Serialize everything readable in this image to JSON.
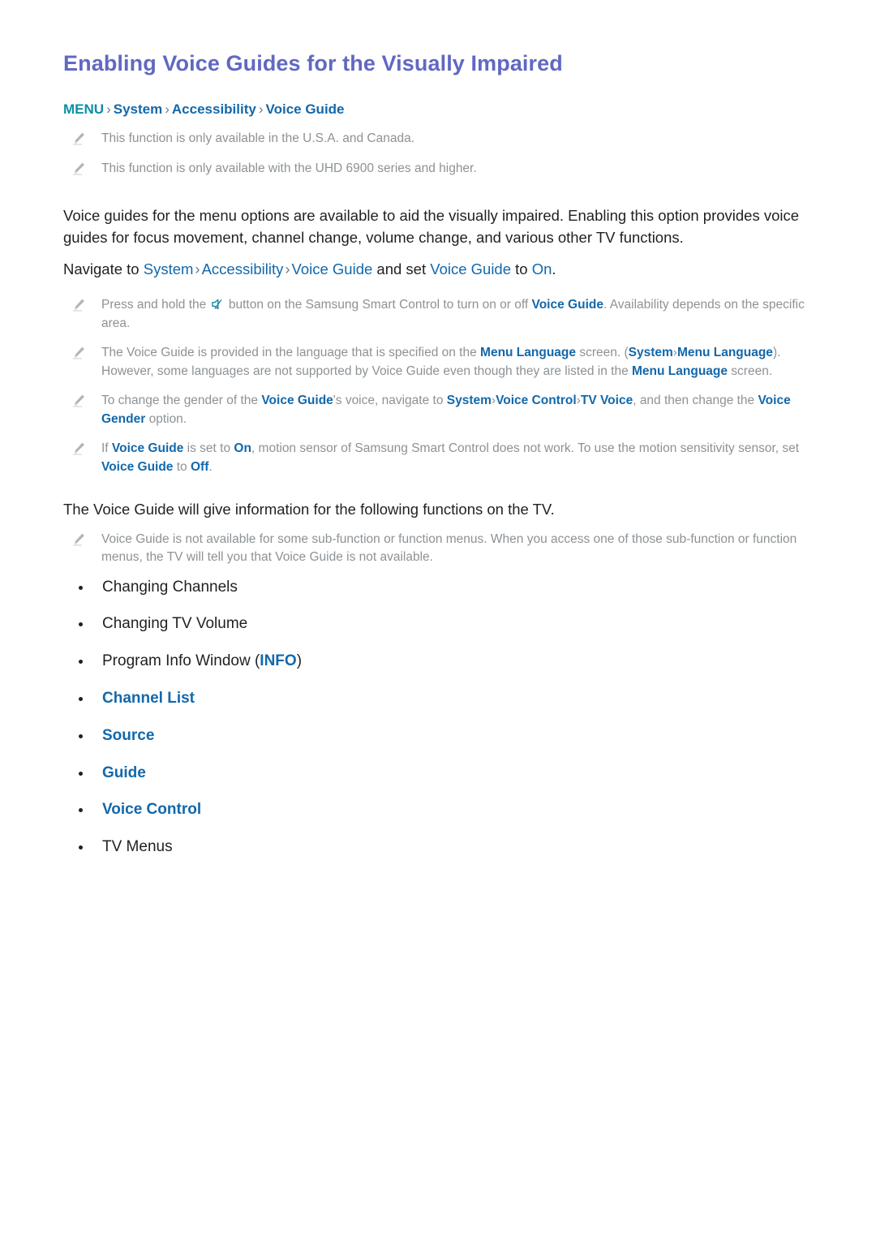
{
  "colors": {
    "title": "#6168c2",
    "link_blue": "#1268ab",
    "menu_teal": "#0d8fa6",
    "note_gray": "#8d9296",
    "body_black": "#231f20"
  },
  "page_title": "Enabling Voice Guides for the Visually Impaired",
  "breadcrumb": {
    "items": [
      "MENU",
      "System",
      "Accessibility",
      "Voice Guide"
    ],
    "separator": "›"
  },
  "top_notes": [
    {
      "text": "This function is only available in the U.S.A. and Canada."
    },
    {
      "text": "This function is only available with the UHD 6900 series and higher."
    }
  ],
  "intro_paragraph": "Voice guides for the menu options are available to aid the visually impaired. Enabling this option provides voice guides for focus movement, channel change, volume change, and various other TV functions.",
  "navigate_line": {
    "lead": "Navigate to ",
    "path": [
      "System",
      "Accessibility",
      "Voice Guide"
    ],
    "separator": "›",
    "mid": " and set ",
    "target": "Voice Guide",
    "to": " to ",
    "value": "On",
    "end": "."
  },
  "notes": [
    {
      "id": "note-smart-control",
      "segments": [
        {
          "type": "text",
          "value": "Press and hold the "
        },
        {
          "type": "icon",
          "value": "mute-icon"
        },
        {
          "type": "text",
          "value": " button on the Samsung Smart Control to turn on or off "
        },
        {
          "type": "link",
          "value": "Voice Guide"
        },
        {
          "type": "text",
          "value": ". Availability depends on the specific area."
        }
      ]
    },
    {
      "id": "note-menu-language",
      "segments": [
        {
          "type": "text",
          "value": "The Voice Guide is provided in the language that is specified on the "
        },
        {
          "type": "link",
          "value": "Menu Language"
        },
        {
          "type": "text",
          "value": " screen. ("
        },
        {
          "type": "link",
          "value": "System"
        },
        {
          "type": "sep",
          "value": "›"
        },
        {
          "type": "link",
          "value": "Menu Language"
        },
        {
          "type": "text",
          "value": "). However, some languages are not supported by Voice Guide even though they are listed in the "
        },
        {
          "type": "link",
          "value": "Menu Language"
        },
        {
          "type": "text",
          "value": " screen."
        }
      ]
    },
    {
      "id": "note-voice-gender",
      "segments": [
        {
          "type": "text",
          "value": "To change the gender of the "
        },
        {
          "type": "link",
          "value": "Voice Guide"
        },
        {
          "type": "text",
          "value": "'s voice, navigate to "
        },
        {
          "type": "link",
          "value": "System"
        },
        {
          "type": "sep",
          "value": "›"
        },
        {
          "type": "link",
          "value": "Voice Control"
        },
        {
          "type": "sep",
          "value": "›"
        },
        {
          "type": "link",
          "value": "TV Voice"
        },
        {
          "type": "text",
          "value": ", and then change the "
        },
        {
          "type": "link",
          "value": "Voice Gender"
        },
        {
          "type": "text",
          "value": " option."
        }
      ]
    },
    {
      "id": "note-motion-sensor",
      "segments": [
        {
          "type": "text",
          "value": "If "
        },
        {
          "type": "link",
          "value": "Voice Guide"
        },
        {
          "type": "text",
          "value": " is set to "
        },
        {
          "type": "link",
          "value": "On"
        },
        {
          "type": "text",
          "value": ", motion sensor of Samsung Smart Control does not work. To use the motion sensitivity sensor, set "
        },
        {
          "type": "link",
          "value": "Voice Guide"
        },
        {
          "type": "text",
          "value": " to "
        },
        {
          "type": "link",
          "value": "Off"
        },
        {
          "type": "text",
          "value": "."
        }
      ]
    }
  ],
  "functions_intro": "The Voice Guide will give information for the following functions on the TV.",
  "availability_note": "Voice Guide is not available for some sub-function or function menus. When you access one of those sub-function or function menus, the TV will tell you that Voice Guide is not available.",
  "function_list": [
    {
      "label": "Changing Channels",
      "style": "plain"
    },
    {
      "label": "Changing TV Volume",
      "style": "plain"
    },
    {
      "label": "Program Info Window (",
      "style": "mixed",
      "inline_link": "INFO",
      "suffix": ")"
    },
    {
      "label": "Channel List",
      "style": "link"
    },
    {
      "label": "Source",
      "style": "link"
    },
    {
      "label": "Guide",
      "style": "link"
    },
    {
      "label": "Voice Control",
      "style": "link"
    },
    {
      "label": "TV Menus",
      "style": "plain"
    }
  ]
}
